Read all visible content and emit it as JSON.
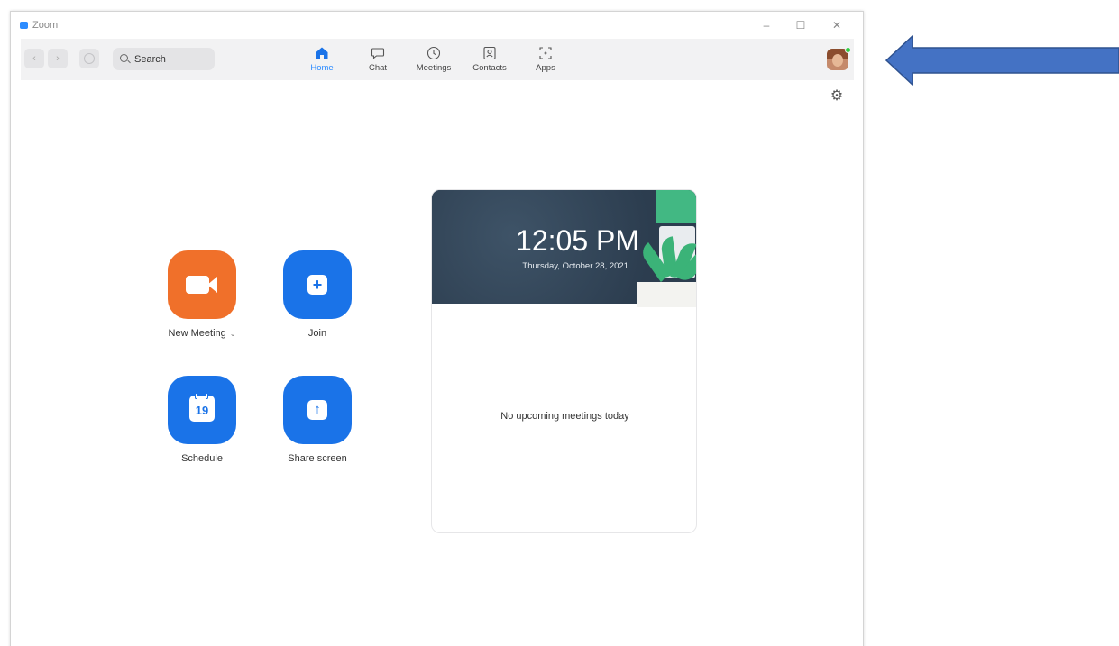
{
  "window": {
    "title": "Zoom",
    "controls": {
      "minimize": "–",
      "maximize": "☐",
      "close": "✕"
    }
  },
  "toolbar": {
    "back_symbol": "‹",
    "forward_symbol": "›",
    "search": {
      "placeholder": "Search",
      "value": ""
    },
    "tabs": [
      {
        "label": "Home",
        "icon": "home-icon",
        "active": true
      },
      {
        "label": "Chat",
        "icon": "chat-icon",
        "active": false
      },
      {
        "label": "Meetings",
        "icon": "clock-icon",
        "active": false
      },
      {
        "label": "Contacts",
        "icon": "contacts-icon",
        "active": false
      },
      {
        "label": "Apps",
        "icon": "apps-icon",
        "active": false
      }
    ],
    "avatar_status": "online"
  },
  "settings_icon": "⚙",
  "actions": {
    "new_meeting": {
      "label": "New Meeting",
      "caret": "⌄",
      "icon": "video-camera-icon"
    },
    "join": {
      "label": "Join",
      "symbol": "+",
      "icon": "plus-icon"
    },
    "schedule": {
      "label": "Schedule",
      "day": "19",
      "icon": "calendar-icon"
    },
    "share_screen": {
      "label": "Share screen",
      "symbol": "↑",
      "icon": "share-arrow-icon"
    }
  },
  "meetings_panel": {
    "time": "12:05 PM",
    "date": "Thursday, October 28, 2021",
    "empty_message": "No upcoming meetings today"
  },
  "colors": {
    "accent_blue": "#1a73e8",
    "new_meeting_orange": "#f0702a",
    "active_tab": "#2d8cff",
    "banner_dark": "#34475a",
    "annotation_arrow": "#4472c4",
    "online_status": "#2ecc40"
  }
}
